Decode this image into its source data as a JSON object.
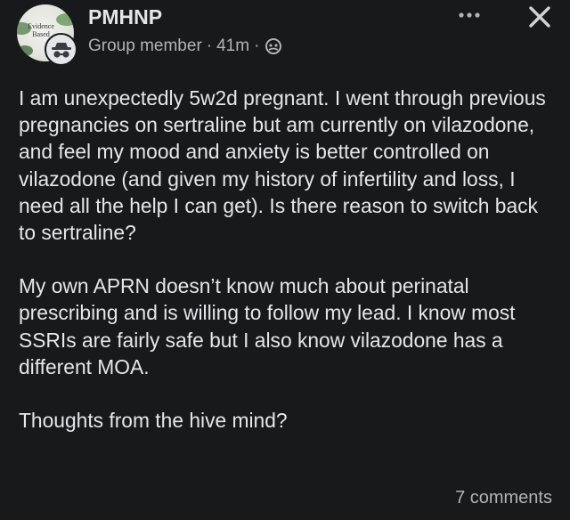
{
  "post": {
    "header": {
      "group_name": "PMHNP",
      "avatar_text": "Evidence Based",
      "member_role": "Group member",
      "separator": "·",
      "time_ago": "41m",
      "audience_icon": "group-audience-icon",
      "badge_icon": "anonymous-member-icon",
      "more_icon": "more-options-icon",
      "close_icon": "close-icon"
    },
    "body": {
      "paragraphs": [
        "I am unexpectedly 5w2d pregnant. I went through previous pregnancies on sertraline but am currently on vilazodone, and feel my mood and anxiety is better controlled on vilazodone (and given my history of infertility and loss, I need all the help I can get). Is there reason to switch back to sertraline?",
        "My own APRN doesn’t know much about perinatal prescribing and is willing to follow my lead. I know most SSRIs are fairly safe but I also know vilazodone has a different MOA.",
        "Thoughts from the hive mind?"
      ]
    },
    "footer": {
      "comments_label": "7 comments"
    },
    "colors": {
      "background": "#18191a",
      "primary_text": "#e4e6eb",
      "secondary_text": "#b0b3b8"
    }
  }
}
